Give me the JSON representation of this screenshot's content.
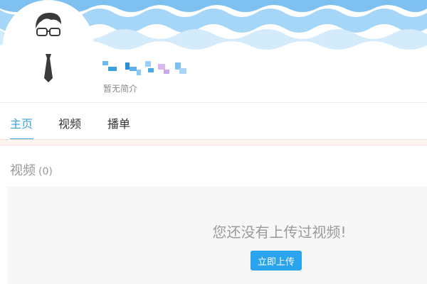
{
  "profile": {
    "intro": "暂无简介"
  },
  "nav": {
    "tabs": [
      {
        "label": "主页",
        "active": true
      },
      {
        "label": "视频",
        "active": false
      },
      {
        "label": "播单",
        "active": false
      }
    ]
  },
  "section": {
    "title": "视频",
    "count": "(0)"
  },
  "empty_state": {
    "message": "您还没有上传过视频!",
    "button_label": "立即上传"
  },
  "colors": {
    "accent": "#3aa1e1",
    "button": "#2aa4ee",
    "banner_wave": "#8fcaf3"
  },
  "icons": {
    "avatar": "default-avatar-glasses-tie"
  }
}
